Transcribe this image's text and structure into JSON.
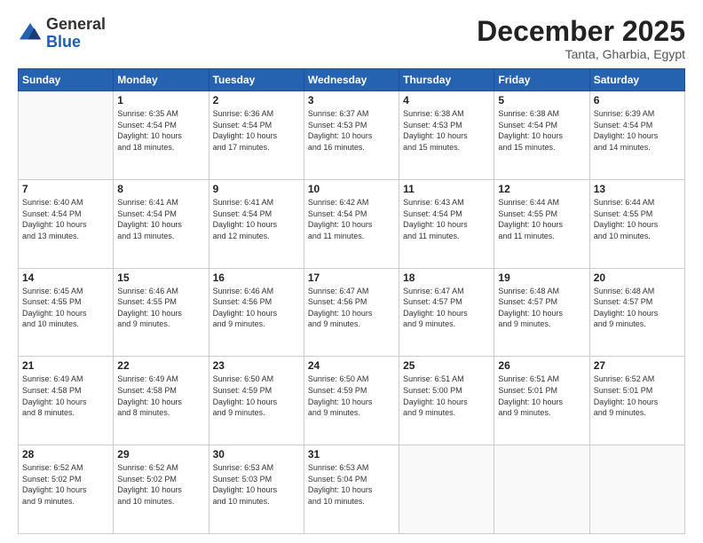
{
  "logo": {
    "general": "General",
    "blue": "Blue"
  },
  "header": {
    "title": "December 2025",
    "subtitle": "Tanta, Gharbia, Egypt"
  },
  "days_of_week": [
    "Sunday",
    "Monday",
    "Tuesday",
    "Wednesday",
    "Thursday",
    "Friday",
    "Saturday"
  ],
  "weeks": [
    [
      {
        "day": "",
        "info": ""
      },
      {
        "day": "1",
        "info": "Sunrise: 6:35 AM\nSunset: 4:54 PM\nDaylight: 10 hours\nand 18 minutes."
      },
      {
        "day": "2",
        "info": "Sunrise: 6:36 AM\nSunset: 4:54 PM\nDaylight: 10 hours\nand 17 minutes."
      },
      {
        "day": "3",
        "info": "Sunrise: 6:37 AM\nSunset: 4:53 PM\nDaylight: 10 hours\nand 16 minutes."
      },
      {
        "day": "4",
        "info": "Sunrise: 6:38 AM\nSunset: 4:53 PM\nDaylight: 10 hours\nand 15 minutes."
      },
      {
        "day": "5",
        "info": "Sunrise: 6:38 AM\nSunset: 4:54 PM\nDaylight: 10 hours\nand 15 minutes."
      },
      {
        "day": "6",
        "info": "Sunrise: 6:39 AM\nSunset: 4:54 PM\nDaylight: 10 hours\nand 14 minutes."
      }
    ],
    [
      {
        "day": "7",
        "info": "Sunrise: 6:40 AM\nSunset: 4:54 PM\nDaylight: 10 hours\nand 13 minutes."
      },
      {
        "day": "8",
        "info": "Sunrise: 6:41 AM\nSunset: 4:54 PM\nDaylight: 10 hours\nand 13 minutes."
      },
      {
        "day": "9",
        "info": "Sunrise: 6:41 AM\nSunset: 4:54 PM\nDaylight: 10 hours\nand 12 minutes."
      },
      {
        "day": "10",
        "info": "Sunrise: 6:42 AM\nSunset: 4:54 PM\nDaylight: 10 hours\nand 11 minutes."
      },
      {
        "day": "11",
        "info": "Sunrise: 6:43 AM\nSunset: 4:54 PM\nDaylight: 10 hours\nand 11 minutes."
      },
      {
        "day": "12",
        "info": "Sunrise: 6:44 AM\nSunset: 4:55 PM\nDaylight: 10 hours\nand 11 minutes."
      },
      {
        "day": "13",
        "info": "Sunrise: 6:44 AM\nSunset: 4:55 PM\nDaylight: 10 hours\nand 10 minutes."
      }
    ],
    [
      {
        "day": "14",
        "info": "Sunrise: 6:45 AM\nSunset: 4:55 PM\nDaylight: 10 hours\nand 10 minutes."
      },
      {
        "day": "15",
        "info": "Sunrise: 6:46 AM\nSunset: 4:55 PM\nDaylight: 10 hours\nand 9 minutes."
      },
      {
        "day": "16",
        "info": "Sunrise: 6:46 AM\nSunset: 4:56 PM\nDaylight: 10 hours\nand 9 minutes."
      },
      {
        "day": "17",
        "info": "Sunrise: 6:47 AM\nSunset: 4:56 PM\nDaylight: 10 hours\nand 9 minutes."
      },
      {
        "day": "18",
        "info": "Sunrise: 6:47 AM\nSunset: 4:57 PM\nDaylight: 10 hours\nand 9 minutes."
      },
      {
        "day": "19",
        "info": "Sunrise: 6:48 AM\nSunset: 4:57 PM\nDaylight: 10 hours\nand 9 minutes."
      },
      {
        "day": "20",
        "info": "Sunrise: 6:48 AM\nSunset: 4:57 PM\nDaylight: 10 hours\nand 9 minutes."
      }
    ],
    [
      {
        "day": "21",
        "info": "Sunrise: 6:49 AM\nSunset: 4:58 PM\nDaylight: 10 hours\nand 8 minutes."
      },
      {
        "day": "22",
        "info": "Sunrise: 6:49 AM\nSunset: 4:58 PM\nDaylight: 10 hours\nand 8 minutes."
      },
      {
        "day": "23",
        "info": "Sunrise: 6:50 AM\nSunset: 4:59 PM\nDaylight: 10 hours\nand 9 minutes."
      },
      {
        "day": "24",
        "info": "Sunrise: 6:50 AM\nSunset: 4:59 PM\nDaylight: 10 hours\nand 9 minutes."
      },
      {
        "day": "25",
        "info": "Sunrise: 6:51 AM\nSunset: 5:00 PM\nDaylight: 10 hours\nand 9 minutes."
      },
      {
        "day": "26",
        "info": "Sunrise: 6:51 AM\nSunset: 5:01 PM\nDaylight: 10 hours\nand 9 minutes."
      },
      {
        "day": "27",
        "info": "Sunrise: 6:52 AM\nSunset: 5:01 PM\nDaylight: 10 hours\nand 9 minutes."
      }
    ],
    [
      {
        "day": "28",
        "info": "Sunrise: 6:52 AM\nSunset: 5:02 PM\nDaylight: 10 hours\nand 9 minutes."
      },
      {
        "day": "29",
        "info": "Sunrise: 6:52 AM\nSunset: 5:02 PM\nDaylight: 10 hours\nand 10 minutes."
      },
      {
        "day": "30",
        "info": "Sunrise: 6:53 AM\nSunset: 5:03 PM\nDaylight: 10 hours\nand 10 minutes."
      },
      {
        "day": "31",
        "info": "Sunrise: 6:53 AM\nSunset: 5:04 PM\nDaylight: 10 hours\nand 10 minutes."
      },
      {
        "day": "",
        "info": ""
      },
      {
        "day": "",
        "info": ""
      },
      {
        "day": "",
        "info": ""
      }
    ]
  ]
}
